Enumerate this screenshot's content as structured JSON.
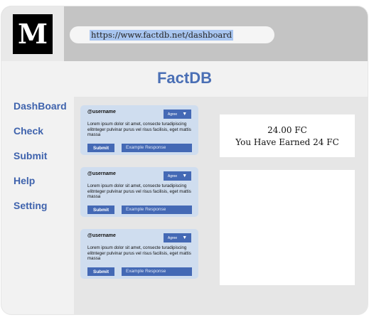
{
  "browser": {
    "logo": "M",
    "url": "https://www.factdb.net/dashboard"
  },
  "app": {
    "title": "FactDB"
  },
  "sidebar": {
    "items": [
      {
        "label": "DashBoard"
      },
      {
        "label": "Check"
      },
      {
        "label": "Submit"
      },
      {
        "label": "Help"
      },
      {
        "label": "Setting"
      }
    ]
  },
  "cards": [
    {
      "username": "@username",
      "agree_label": "Agree",
      "text": "Lorem ipsum dolor sit amet, consecte turadipiscing elitnteger pulvinar purus vel risus facilisis, eget mattis massa",
      "submit_label": "Submit",
      "response_placeholder": "Example Response"
    },
    {
      "username": "@username",
      "agree_label": "Agree",
      "text": "Lorem ipsum dolor sit amet, consecte turadipiscing elitnteger pulvinar purus vel risus facilisis, eget mattis massa",
      "submit_label": "Submit",
      "response_placeholder": "Example Response"
    },
    {
      "username": "@username",
      "agree_label": "Agree",
      "text": "Lorem ipsum dolor sit amet, consecte turadipiscing elitnteger pulvinar purus vel risus facilisis, eget mattis massa",
      "submit_label": "Submit",
      "response_placeholder": "Example Response"
    }
  ],
  "earnings": {
    "amount": "24.00 FC",
    "message": "You Have Earned 24 FC"
  },
  "icons": {
    "dropdown": "chevron-down-icon",
    "caret_glyph": "▼"
  },
  "colors": {
    "accent": "#4469b5",
    "title": "#4a6fb5",
    "card_bg": "#cfddef",
    "url_highlight": "#a8c5f0"
  }
}
